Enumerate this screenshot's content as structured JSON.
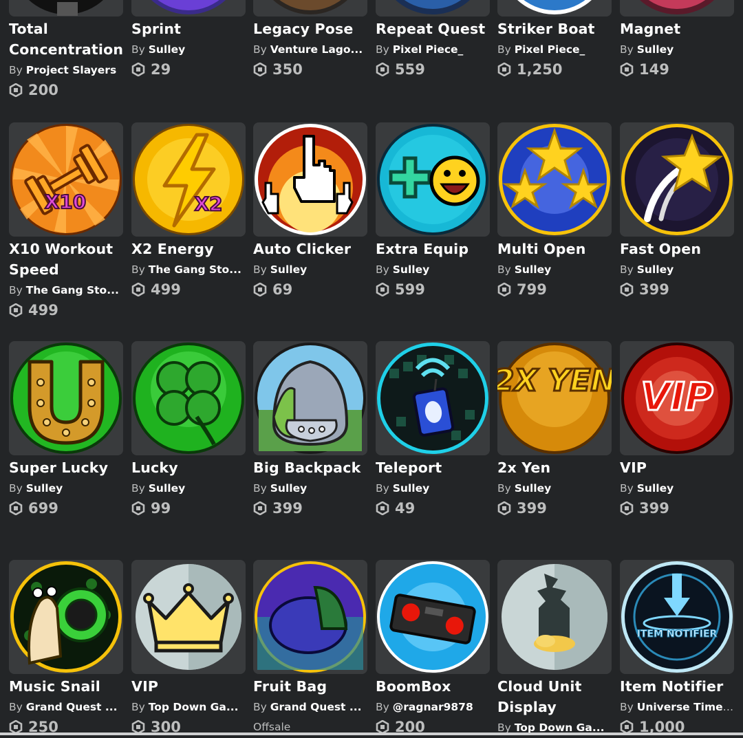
{
  "items": [
    {
      "name": "Total Concentration",
      "by": "By",
      "creator": "Project Slayers",
      "price": "200",
      "icon": "breathing-icon"
    },
    {
      "name": "Sprint",
      "by": "By",
      "creator": "Sulley",
      "price": "29",
      "icon": "sprint-icon"
    },
    {
      "name": "Legacy Pose",
      "by": "By",
      "creator": "Venture Lago...",
      "price": "350",
      "icon": "pose-icon"
    },
    {
      "name": "Repeat Quest",
      "by": "By",
      "creator": "Pixel Piece_",
      "price": "559",
      "icon": "quest-icon"
    },
    {
      "name": "Striker Boat",
      "by": "By",
      "creator": "Pixel Piece_",
      "price": "1,250",
      "icon": "boat-icon"
    },
    {
      "name": "Magnet",
      "by": "By",
      "creator": "Sulley",
      "price": "149",
      "icon": "magnet-icon"
    },
    {
      "name": "X10 Workout Speed",
      "by": "By",
      "creator": "The Gang Sto...",
      "price": "499",
      "icon": "dumbbell-icon",
      "badge": "X10"
    },
    {
      "name": "X2 Energy",
      "by": "By",
      "creator": "The Gang Sto...",
      "price": "499",
      "icon": "lightning-icon",
      "badge": "X2"
    },
    {
      "name": "Auto Clicker",
      "by": "By",
      "creator": "Sulley",
      "price": "69",
      "icon": "cursor-hand-icon"
    },
    {
      "name": "Extra Equip",
      "by": "By",
      "creator": "Sulley",
      "price": "599",
      "icon": "plus-smiley-icon"
    },
    {
      "name": "Multi Open",
      "by": "By",
      "creator": "Sulley",
      "price": "799",
      "icon": "stars-icon"
    },
    {
      "name": "Fast Open",
      "by": "By",
      "creator": "Sulley",
      "price": "399",
      "icon": "shooting-star-icon"
    },
    {
      "name": "Super Lucky",
      "by": "By",
      "creator": "Sulley",
      "price": "699",
      "icon": "horseshoe-icon"
    },
    {
      "name": "Lucky",
      "by": "By",
      "creator": "Sulley",
      "price": "99",
      "icon": "clover-icon"
    },
    {
      "name": "Big Backpack",
      "by": "By",
      "creator": "Sulley",
      "price": "399",
      "icon": "backpack-icon"
    },
    {
      "name": "Teleport",
      "by": "By",
      "creator": "Sulley",
      "price": "49",
      "icon": "teleport-device-icon"
    },
    {
      "name": "2x Yen",
      "by": "By",
      "creator": "Sulley",
      "price": "399",
      "icon": "yen-icon",
      "badge": "2X YEN"
    },
    {
      "name": "VIP",
      "by": "By",
      "creator": "Sulley",
      "price": "399",
      "icon": "vip-icon",
      "badge": "VIP"
    },
    {
      "name": "Music Snail",
      "by": "By",
      "creator": "Grand Quest ...",
      "price": "250",
      "icon": "snail-icon"
    },
    {
      "name": "VIP",
      "by": "By",
      "creator": "Top Down Ga...",
      "price": "300",
      "icon": "crown-icon"
    },
    {
      "name": "Fruit Bag",
      "by": "By",
      "creator": "Grand Quest ...",
      "price": "Offsale",
      "offsale": true,
      "icon": "fruit-bag-icon"
    },
    {
      "name": "BoomBox",
      "by": "By",
      "creator": "@ragnar9878",
      "price": "200",
      "icon": "boombox-icon"
    },
    {
      "name": "Cloud Unit Display",
      "by": "By",
      "creator": "Top Down Ga...",
      "price": "",
      "icon": "cloud-unit-icon"
    },
    {
      "name": "Item Notifier",
      "by": "By",
      "creator": "Universe Time...",
      "price": "1,000",
      "icon": "notifier-icon",
      "badge": "ITEM NOTIFIER"
    }
  ]
}
